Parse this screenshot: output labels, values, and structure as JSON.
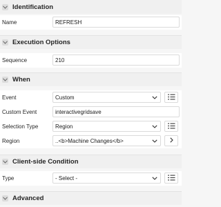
{
  "sections": {
    "identification": "Identification",
    "execution_options": "Execution Options",
    "when": "When",
    "client_side": "Client-side Condition",
    "advanced": "Advanced"
  },
  "fields": {
    "name": {
      "label": "Name",
      "value": "REFRESH"
    },
    "sequence": {
      "label": "Sequence",
      "value": "210"
    },
    "event": {
      "label": "Event",
      "value": "Custom"
    },
    "custom_event": {
      "label": "Custom Event",
      "value": "interactivegridsave"
    },
    "selection_type": {
      "label": "Selection Type",
      "value": "Region"
    },
    "region": {
      "label": "Region",
      "value": "..<b>Machine Changes</b>"
    },
    "type": {
      "label": "Type",
      "value": "- Select -"
    }
  },
  "icons": {
    "collapse": "chevron-down-icon",
    "list": "list-icon",
    "dropdown": "caret-down-icon",
    "go": "chevron-right-icon"
  }
}
